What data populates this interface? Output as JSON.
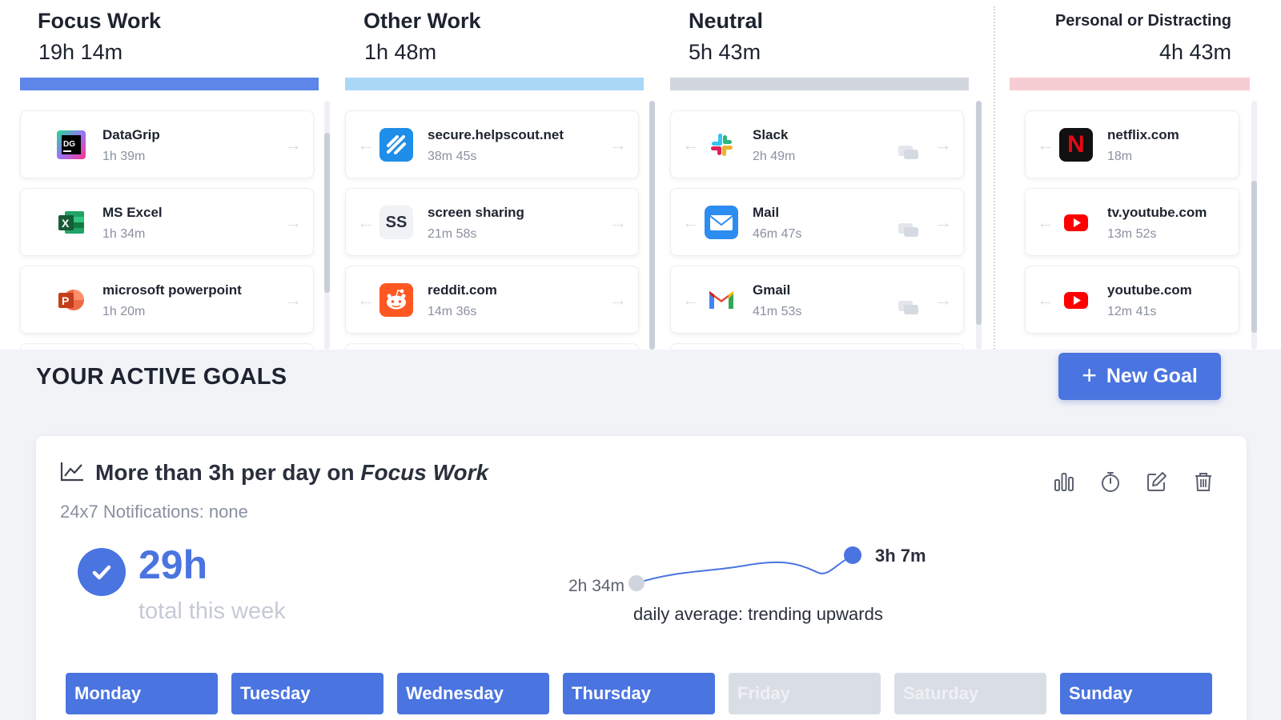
{
  "colors": {
    "focus": "#5c86e8",
    "other": "#a9d8f7",
    "neutral": "#d2d6df",
    "personal": "#f6cdd3",
    "accent": "#4a74e0",
    "inactive_day": "#d9dde5"
  },
  "categories": [
    {
      "title": "Focus Work",
      "total": "19h 14m",
      "items": [
        {
          "name": "DataGrip",
          "duration": "1h 39m",
          "icon": "datagrip-icon"
        },
        {
          "name": "MS Excel",
          "duration": "1h 34m",
          "icon": "excel-icon"
        },
        {
          "name": "microsoft powerpoint",
          "duration": "1h 20m",
          "icon": "powerpoint-icon"
        }
      ]
    },
    {
      "title": "Other Work",
      "total": "1h 48m",
      "items": [
        {
          "name": "secure.helpscout.net",
          "duration": "38m 45s",
          "icon": "helpscout-icon"
        },
        {
          "name": "screen sharing",
          "duration": "21m 58s",
          "icon": "screen-sharing-icon",
          "icon_text": "SS"
        },
        {
          "name": "reddit.com",
          "duration": "14m 36s",
          "icon": "reddit-icon"
        }
      ]
    },
    {
      "title": "Neutral",
      "total": "5h 43m",
      "items": [
        {
          "name": "Slack",
          "duration": "2h 49m",
          "icon": "slack-icon"
        },
        {
          "name": "Mail",
          "duration": "46m 47s",
          "icon": "mail-icon"
        },
        {
          "name": "Gmail",
          "duration": "41m 53s",
          "icon": "gmail-icon"
        }
      ]
    },
    {
      "title": "Personal or Distracting",
      "total": "4h 43m",
      "items": [
        {
          "name": "netflix.com",
          "duration": "18m",
          "icon": "netflix-icon",
          "icon_text": "N"
        },
        {
          "name": "tv.youtube.com",
          "duration": "13m 52s",
          "icon": "youtube-icon"
        },
        {
          "name": "youtube.com",
          "duration": "12m 41s",
          "icon": "youtube-icon"
        }
      ]
    }
  ],
  "goals": {
    "section_title": "YOUR ACTIVE GOALS",
    "new_goal_label": "New Goal",
    "goal": {
      "title_prefix": "More than 3h per day on ",
      "title_category": "Focus Work",
      "notifications": "24x7 Notifications: none",
      "total": "29h",
      "total_caption": "total this week",
      "trend": {
        "start_label": "2h 34m",
        "end_label": "3h 7m",
        "caption": "daily average: trending upwards"
      },
      "actions": [
        "bar-chart-icon",
        "stopwatch-icon",
        "edit-icon",
        "trash-icon"
      ],
      "days": [
        {
          "label": "Monday",
          "met": true
        },
        {
          "label": "Tuesday",
          "met": true
        },
        {
          "label": "Wednesday",
          "met": true
        },
        {
          "label": "Thursday",
          "met": true
        },
        {
          "label": "Friday",
          "met": false
        },
        {
          "label": "Saturday",
          "met": false
        },
        {
          "label": "Sunday",
          "met": true
        }
      ]
    }
  }
}
